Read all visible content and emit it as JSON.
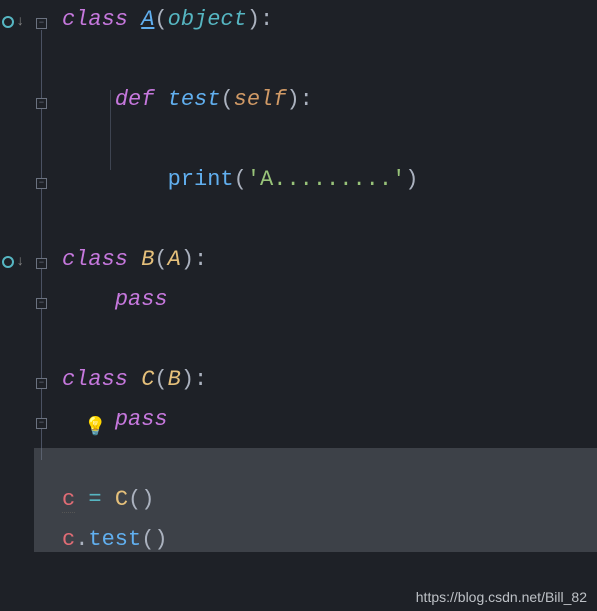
{
  "code": {
    "line1": {
      "kw": "class ",
      "cls": "A",
      "p1": "(",
      "base": "object",
      "p2": "):"
    },
    "line3": {
      "kw": "def ",
      "fn": "test",
      "p1": "(",
      "param": "self",
      "p2": "):"
    },
    "line5": {
      "fn": "print",
      "p1": "(",
      "str": "'A.........'",
      "p2": ")"
    },
    "line7": {
      "kw": "class ",
      "cls": "B",
      "p1": "(",
      "base": "A",
      "p2": "):"
    },
    "line8": {
      "kw": "pass"
    },
    "line10": {
      "kw": "class ",
      "cls": "C",
      "p1": "(",
      "base": "B",
      "p2": "):"
    },
    "line11": {
      "kw": "pass"
    },
    "line13": {
      "var": "c",
      "op": " = ",
      "cls": "C",
      "call": "()"
    },
    "line14": {
      "var": "c",
      "dot": ".",
      "fn": "test",
      "call": "()"
    }
  },
  "icons": {
    "override": "o",
    "fold_minus": "−",
    "bulb": "💡"
  },
  "watermark": "https://blog.csdn.net/Bill_82"
}
